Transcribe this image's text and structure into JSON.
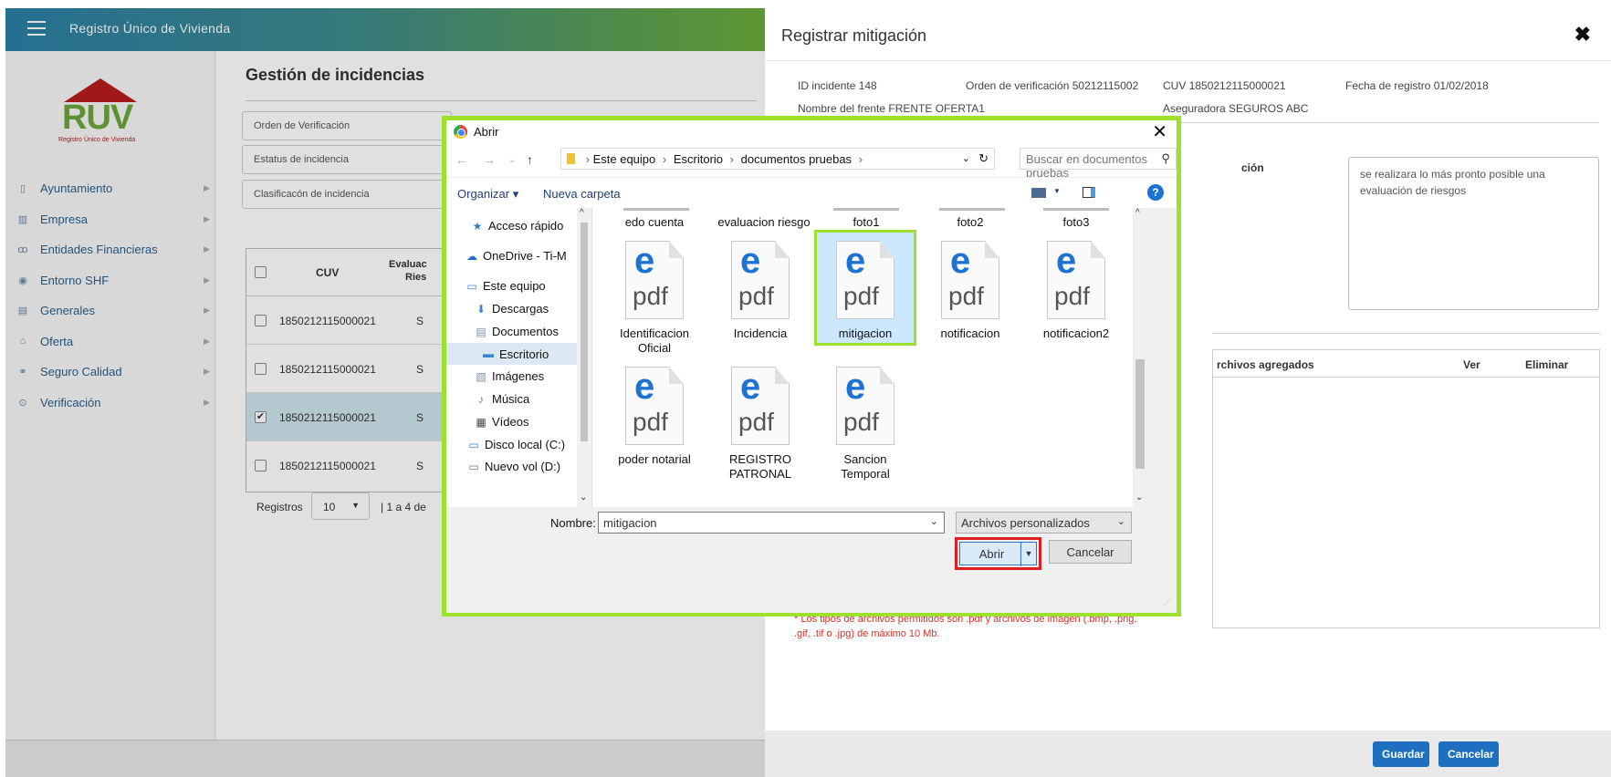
{
  "app": {
    "title": "Registro Único de Vivienda",
    "logo_text": "RUV",
    "logo_sub": "Registro Único de Vivienda",
    "nav": [
      {
        "label": "Ayuntamiento",
        "icon": "map-icon"
      },
      {
        "label": "Empresa",
        "icon": "building-icon"
      },
      {
        "label": "Entidades Financieras",
        "icon": "people-icon"
      },
      {
        "label": "Entorno SHF",
        "icon": "target-icon"
      },
      {
        "label": "Generales",
        "icon": "clipboard-icon"
      },
      {
        "label": "Oferta",
        "icon": "home-icon"
      },
      {
        "label": "Seguro Calidad",
        "icon": "handshake-icon"
      },
      {
        "label": "Verificación",
        "icon": "check-circle-icon"
      }
    ],
    "page_title": "Gestión de incidencias",
    "filters": [
      "Orden de Verificación",
      "Estatus de incidencia",
      "Clasificacón de incidencia"
    ],
    "table": {
      "headers": [
        "CUV",
        "Evaluac",
        "Ries"
      ],
      "rows": [
        {
          "cuv": "1850212115000021",
          "col": "S",
          "checked": false
        },
        {
          "cuv": "1850212115000021",
          "col": "S",
          "checked": false
        },
        {
          "cuv": "1850212115000021",
          "col": "S",
          "checked": true
        },
        {
          "cuv": "1850212115000021",
          "col": "S",
          "checked": false
        }
      ]
    },
    "registros_label": "Registros",
    "page_size": "10",
    "page_info": "| 1 a 4 de"
  },
  "panel": {
    "title": "Registrar mitigación",
    "id_incidente": "ID incidente 148",
    "orden": "Orden de verificación 50212115002",
    "cuv": "CUV 1850212115000021",
    "fecha": "Fecha de registro 01/02/2018",
    "nombre_frente": "Nombre del frente FRENTE OFERTA1",
    "aseguradora": "Aseguradora SEGUROS ABC",
    "descripcion_label": "ción",
    "descripcion": "se realizara lo más pronto posible una evaluación de riesgos",
    "files_header": "rchivos agregados",
    "ver_header": "Ver",
    "eliminar_header": "Eliminar",
    "note": "* Los tipos de archivos permitidos son .pdf y archivos de imagen (.bmp, .png, .gif, .tif o .jpg) de máximo 10 Mb.",
    "guardar": "Guardar",
    "cancelar": "Cancelar"
  },
  "dialog": {
    "title": "Abrir",
    "path": [
      "Este equipo",
      "Escritorio",
      "documentos pruebas"
    ],
    "search_placeholder": "Buscar en documentos pruebas",
    "organizar": "Organizar ▾",
    "nueva_carpeta": "Nueva carpeta",
    "nav": [
      {
        "label": "Acceso rápido",
        "icon": "star-icon"
      },
      {
        "label": "OneDrive - Ti-M",
        "icon": "cloud-icon"
      },
      {
        "label": "Este equipo",
        "icon": "computer-icon"
      },
      {
        "label": "Descargas",
        "icon": "download-folder-icon"
      },
      {
        "label": "Documentos",
        "icon": "documents-folder-icon"
      },
      {
        "label": "Escritorio",
        "icon": "desktop-folder-icon",
        "selected": true
      },
      {
        "label": "Imágenes",
        "icon": "pictures-folder-icon"
      },
      {
        "label": "Música",
        "icon": "music-folder-icon"
      },
      {
        "label": "Vídeos",
        "icon": "videos-folder-icon"
      },
      {
        "label": "Disco local (C:)",
        "icon": "disk-icon"
      },
      {
        "label": "Nuevo vol (D:)",
        "icon": "drive-icon"
      }
    ],
    "top_files": [
      "edo cuenta",
      "evaluacion riesgo",
      "foto1",
      "foto2",
      "foto3"
    ],
    "files": [
      {
        "label": "Identificacion Oficial"
      },
      {
        "label": "Incidencia"
      },
      {
        "label": "mitigacion",
        "selected": true
      },
      {
        "label": "notificacion"
      },
      {
        "label": "notificacion2"
      },
      {
        "label": "poder notarial"
      },
      {
        "label": "REGISTRO PATRONAL"
      },
      {
        "label": "Sancion Temporal"
      }
    ],
    "pdf_label": "pdf",
    "nombre_label": "Nombre:",
    "nombre_value": "mitigacion",
    "file_type": "Archivos personalizados",
    "abrir": "Abrir",
    "cancelar": "Cancelar"
  }
}
